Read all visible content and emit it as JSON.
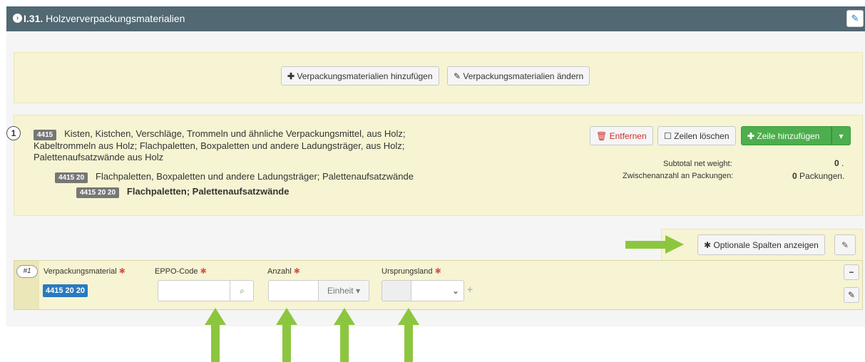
{
  "header": {
    "code": "I.31.",
    "title": "Holzververpackungsmaterialien"
  },
  "toolbar": {
    "add_label": "Verpackungsmaterialien hinzufügen",
    "change_label": "Verpackungsmaterialien ändern"
  },
  "item": {
    "number": "1",
    "level1_code": "4415",
    "level1_text_line1": "Kisten, Kistchen, Verschläge, Trommeln und ähnliche Verpackungsmittel, aus Holz;",
    "level1_text_line2": "Kabeltrommeln aus Holz; Flachpaletten, Boxpaletten und andere Ladungsträger, aus Holz;",
    "level1_text_line3": "Palettenaufsatzwände aus Holz",
    "level2_code": "4415 20",
    "level2_text": "Flachpaletten, Boxpaletten und andere Ladungsträger; Palettenaufsatzwände",
    "level3_code": "4415 20 20",
    "level3_text": "Flachpaletten; Palettenaufsatzwände",
    "remove_label": "Entfernen",
    "clear_label": "Zeilen löschen",
    "add_row_label": "Zeile hinzufügen",
    "subtotal_label": "Subtotal net weight:",
    "subtotal_value": "0",
    "subtotal_suffix": ".",
    "packages_label": "Zwischenanzahl an Packungen:",
    "packages_value": "0",
    "packages_unit": "Packungen."
  },
  "optional_columns_label": "Optionale Spalten anzeigen",
  "row": {
    "row_number": "#1",
    "col_material": "Verpackungsmaterial",
    "col_eppo": "EPPO-Code",
    "col_count": "Anzahl",
    "col_origin": "Ursprungsland",
    "material_value": "4415 20 20",
    "unit_label": "Einheit",
    "eppo_value": "",
    "count_value": ""
  },
  "colors": {
    "header": "#526873",
    "yellow_bg": "#f6f4d2",
    "green_button": "#4cae4c",
    "annotation_arrow": "#8cc63f",
    "material_badge": "#2a7ac0"
  },
  "icons": [
    "chevron-circle-icon",
    "edit-icon",
    "plus-icon",
    "pencil-icon",
    "trash-icon",
    "checkbox-icon",
    "caret-down-icon",
    "asterisk-icon",
    "search-icon",
    "minus-icon"
  ]
}
